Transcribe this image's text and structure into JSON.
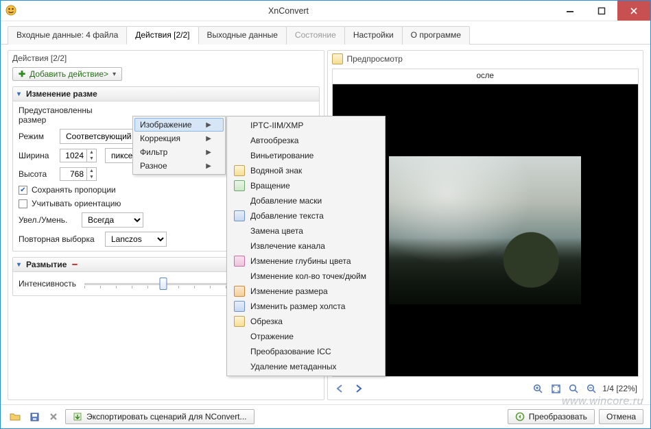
{
  "window": {
    "title": "XnConvert"
  },
  "tabs": [
    {
      "label": "Входные данные: 4 файла"
    },
    {
      "label": "Действия [2/2]",
      "active": true
    },
    {
      "label": "Выходные данные"
    },
    {
      "label": "Состояние",
      "disabled": true
    },
    {
      "label": "Настройки"
    },
    {
      "label": "О программе"
    }
  ],
  "left": {
    "title": "Действия [2/2]",
    "add_button": "Добавить действие>",
    "resize": {
      "title": "Изменение разме",
      "preset_label": "Предустановленны\nразмер",
      "mode_label": "Режим",
      "mode_value": "Соответсвующий",
      "width_label": "Ширина",
      "width_value": "1024",
      "height_label": "Высота",
      "height_value": "768",
      "unit_value": "пиксел",
      "keep_ratio": "Сохранять пропорции",
      "keep_ratio_checked": true,
      "use_orientation": "Учитывать ориентацию",
      "use_orientation_checked": false,
      "scale_label": "Увел./Умень.",
      "scale_value": "Всегда",
      "resample_label": "Повторная выборка",
      "resample_value": "Lanczos"
    },
    "blur": {
      "title": "Размытие",
      "intensity_label": "Интенсивность"
    }
  },
  "menu1": [
    {
      "label": "Изображение",
      "submenu": true,
      "hover": true
    },
    {
      "label": "Коррекция",
      "submenu": true
    },
    {
      "label": "Фильтр",
      "submenu": true
    },
    {
      "label": "Разное",
      "submenu": true
    }
  ],
  "menu2": [
    {
      "label": "IPTC-IIM/XMP"
    },
    {
      "label": "Автообрезка"
    },
    {
      "label": "Виньетирование"
    },
    {
      "label": "Водяной знак",
      "icon": "sq"
    },
    {
      "label": "Вращение",
      "icon": "gr"
    },
    {
      "label": "Добавление маски"
    },
    {
      "label": "Добавление текста",
      "icon": "bl"
    },
    {
      "label": "Замена цвета"
    },
    {
      "label": "Извлечение канала"
    },
    {
      "label": "Изменение глубины цвета",
      "icon": "pk"
    },
    {
      "label": "Изменение кол-во точек/дюйм"
    },
    {
      "label": "Изменение размера",
      "icon": "or"
    },
    {
      "label": "Изменить размер холста",
      "icon": "bl"
    },
    {
      "label": "Обрезка",
      "icon": "sq"
    },
    {
      "label": "Отражение"
    },
    {
      "label": "Преобразование ICC"
    },
    {
      "label": "Удаление метаданных"
    }
  ],
  "right": {
    "title": "Предпросмотр",
    "tab_after": "осле",
    "info": "1/4 [22%]"
  },
  "footer": {
    "export_label": "Экспортировать сценарий для NConvert...",
    "convert_label": "Преобразовать",
    "cancel_label": "Отмена"
  },
  "watermark": "www.wincore.ru"
}
